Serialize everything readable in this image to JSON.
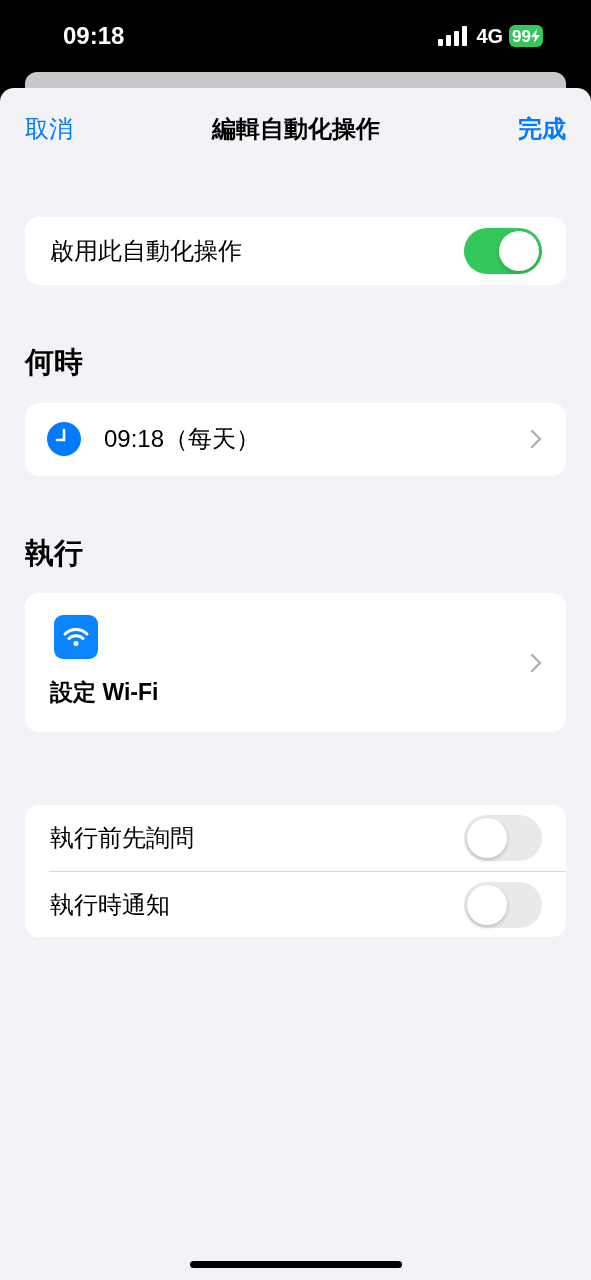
{
  "status_bar": {
    "time": "09:18",
    "network": "4G",
    "battery": "99"
  },
  "nav": {
    "cancel": "取消",
    "title": "編輯自動化操作",
    "done": "完成"
  },
  "enable": {
    "label": "啟用此自動化操作",
    "on": true
  },
  "sections": [
    {
      "header": "何時",
      "kind": "trigger",
      "text": "09:18（每天）"
    },
    {
      "header": "執行",
      "kind": "action",
      "text": "設定 Wi-Fi"
    }
  ],
  "options": [
    {
      "label": "執行前先詢問",
      "on": false
    },
    {
      "label": "執行時通知",
      "on": false
    }
  ]
}
